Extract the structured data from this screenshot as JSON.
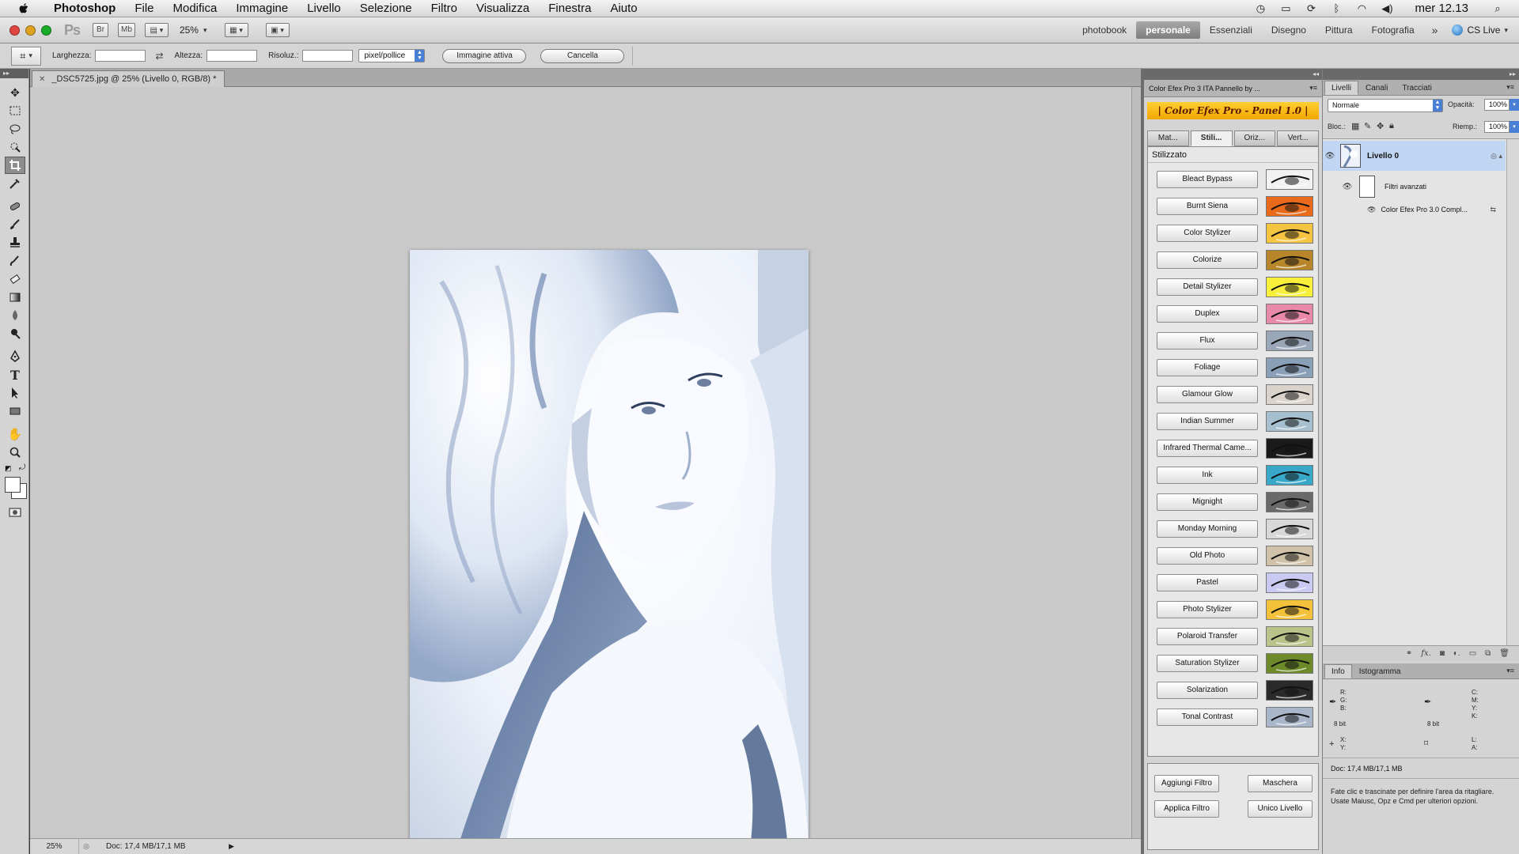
{
  "menubar": {
    "app_name": "Photoshop",
    "menus": [
      "File",
      "Modifica",
      "Immagine",
      "Livello",
      "Selezione",
      "Filtro",
      "Visualizza",
      "Finestra",
      "Aiuto"
    ],
    "clock": "mer 12.13"
  },
  "appbar": {
    "badge": "Ps",
    "bridge": "Br",
    "minibridge": "Mb",
    "zoom": "25%",
    "workspaces": [
      "photobook",
      "personale",
      "Essenziali",
      "Disegno",
      "Pittura",
      "Fotografia"
    ],
    "active_workspace": "personale",
    "cs_live": "CS Live"
  },
  "options": {
    "width_label": "Larghezza:",
    "height_label": "Altezza:",
    "resolution_label": "Risoluz.:",
    "unit": "pixel/pollice",
    "front_image_button": "Immagine attiva",
    "clear_button": "Cancella"
  },
  "document": {
    "tab_title": "_DSC5725.jpg @ 25% (Livello 0, RGB/8) *",
    "status_zoom": "25%",
    "status_doc": "Doc: 17,4 MB/17,1 MB"
  },
  "cfx": {
    "panel_title": "Color Efex Pro 3 ITA Pannello by ...",
    "banner": "| Color Efex Pro - Panel 1.0 |",
    "tabs": [
      "Mat...",
      "Stili...",
      "Oriz...",
      "Vert..."
    ],
    "active_tab": "Stili...",
    "category": "Stilizzato",
    "filters": [
      {
        "label": "Bleact Bypass",
        "tint": "#f2f2f2"
      },
      {
        "label": "Burnt Siena",
        "tint": "#e86a1a"
      },
      {
        "label": "Color Stylizer",
        "tint": "#f5c542"
      },
      {
        "label": "Colorize",
        "tint": "#b8862a"
      },
      {
        "label": "Detail Stylizer",
        "tint": "#f7ef3a"
      },
      {
        "label": "Duplex",
        "tint": "#e889a9"
      },
      {
        "label": "Flux",
        "tint": "#9aa7b8"
      },
      {
        "label": "Foliage",
        "tint": "#8aa0b8"
      },
      {
        "label": "Glamour Glow",
        "tint": "#d9d3cc"
      },
      {
        "label": "Indian Summer",
        "tint": "#a6c0cf"
      },
      {
        "label": "Infrared Thermal Came...",
        "tint": "#1a1a1a"
      },
      {
        "label": "Ink",
        "tint": "#39a8c8"
      },
      {
        "label": "Mignight",
        "tint": "#6a6a6a"
      },
      {
        "label": "Monday Morning",
        "tint": "#d8d8d8"
      },
      {
        "label": "Old Photo",
        "tint": "#cfc2a8"
      },
      {
        "label": "Pastel",
        "tint": "#c9c9f2"
      },
      {
        "label": "Photo Stylizer",
        "tint": "#f3c23a"
      },
      {
        "label": "Polaroid Transfer",
        "tint": "#b9c48a"
      },
      {
        "label": "Saturation Stylizer",
        "tint": "#6d8a2a"
      },
      {
        "label": "Solarization",
        "tint": "#2a2a2a"
      },
      {
        "label": "Tonal Contrast",
        "tint": "#a9b6c9"
      }
    ],
    "add_filter": "Aggiungi Filtro",
    "mask": "Maschera",
    "apply_filter": "Applica Filtro",
    "single_layer": "Unico Livello"
  },
  "layers": {
    "tabs": [
      "Livelli",
      "Canali",
      "Tracciati"
    ],
    "blend_mode": "Normale",
    "opacity_label": "Opacità:",
    "opacity": "100%",
    "lock_label": "Bloc.:",
    "fill_label": "Riemp.:",
    "fill": "100%",
    "layer_name": "Livello 0",
    "smart_filters": "Filtri avanzati",
    "smart_filter_item": "Color Efex Pro 3.0 Compl..."
  },
  "info": {
    "tabs": [
      "Info",
      "Istogramma"
    ],
    "rgb_labels": [
      "R:",
      "G:",
      "B:"
    ],
    "cmyk_labels": [
      "C:",
      "M:",
      "Y:",
      "K:"
    ],
    "bits_left": "8 bit",
    "bits_right": "8 bit",
    "xy_labels": [
      "X:",
      "Y:"
    ],
    "la_labels": [
      "L:",
      "A:"
    ],
    "doc": "Doc: 17,4 MB/17,1 MB",
    "hint": "Fate clic e trascinate per definire l'area da ritagliare. Usate Maiusc, Opz e Cmd per ulteriori opzioni."
  }
}
